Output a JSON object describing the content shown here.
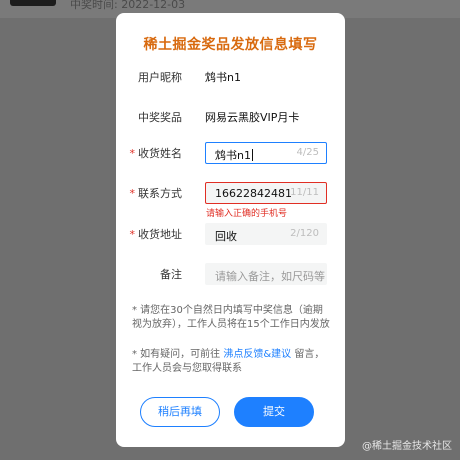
{
  "background": {
    "date_text": "中奖时间: 2022-12-03"
  },
  "modal": {
    "title": "稀土掘金奖品发放信息填写",
    "nickname": {
      "label": "用户昵称",
      "value": "鸩书n1"
    },
    "prize": {
      "label": "中奖奖品",
      "value": "网易云黑胶VIP月卡"
    },
    "receiver_name": {
      "required_mark": "*",
      "label": "收货姓名",
      "value": "鸩书n1",
      "counter": "4/25"
    },
    "contact": {
      "required_mark": "*",
      "label": "联系方式",
      "value": "16622842481",
      "counter": "11/11",
      "error": "请输入正确的手机号"
    },
    "address": {
      "required_mark": "*",
      "label": "收货地址",
      "value": "回收",
      "counter": "2/120"
    },
    "remark": {
      "label": "备注",
      "placeholder": "请输入备注，如尺码等"
    },
    "note1": "* 请您在30个自然日内填写中奖信息（逾期视为放弃），工作人员将在15个工作日内发放",
    "note2_prefix": "* 如有疑问，可前往 ",
    "note2_link": "沸点反馈&建议",
    "note2_suffix": " 留言，工作人员会与您取得联系",
    "later_button": "稍后再填",
    "submit_button": "提交"
  },
  "watermark": "@稀土掘金技术社区",
  "colors": {
    "accent": "#1e80ff",
    "title": "#d86a0f",
    "error": "#e02e24"
  }
}
